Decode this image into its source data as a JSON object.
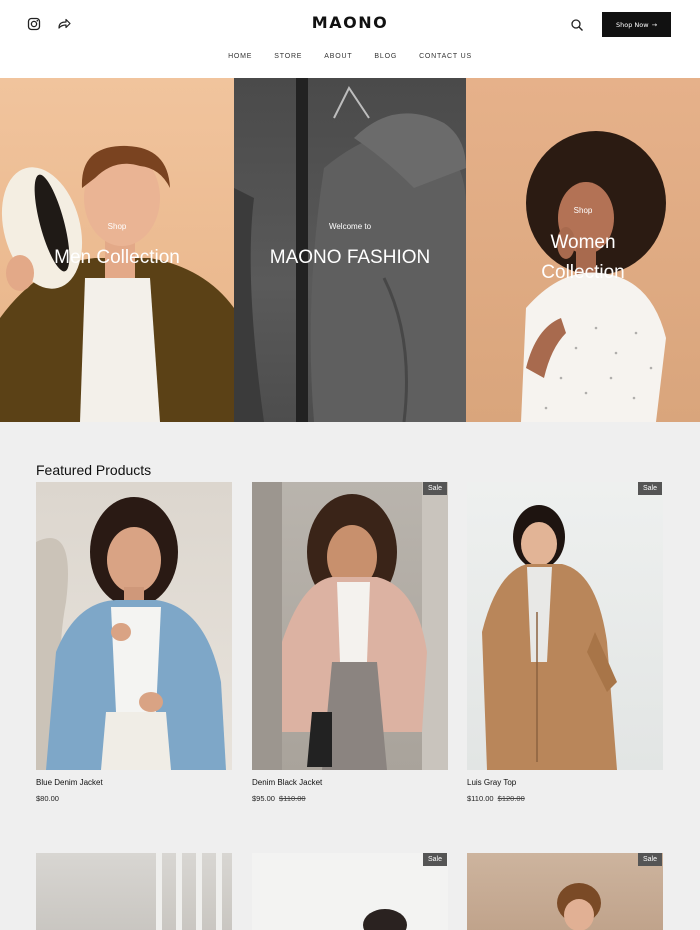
{
  "header": {
    "logo": "MAONO",
    "shop_button": "Shop Now",
    "shop_button_arrow": "→",
    "nav": [
      "HOME",
      "STORE",
      "ABOUT",
      "BLOG",
      "CONTACT US"
    ]
  },
  "icons": {
    "instagram": "instagram-icon",
    "share": "share-icon",
    "search": "search-icon"
  },
  "hero": {
    "men": {
      "small": "Shop",
      "title": "Men Collection"
    },
    "center": {
      "small": "Welcome to",
      "title": "MAONO FASHION"
    },
    "women": {
      "small": "Shop",
      "title_line1": "Women",
      "title_line2": "Collection"
    }
  },
  "featured": {
    "title": "Featured Products",
    "products": [
      {
        "name": "Blue Denim Jacket",
        "price": "$80.00",
        "old_price": "",
        "sale": ""
      },
      {
        "name": "Denim Black Jacket",
        "price": "$95.00",
        "old_price": "$110.00",
        "sale": "Sale"
      },
      {
        "name": "Luis Gray Top",
        "price": "$110.00",
        "old_price": "$120.00",
        "sale": "Sale"
      }
    ],
    "second_row": [
      {
        "sale": ""
      },
      {
        "sale": "Sale"
      },
      {
        "sale": "Sale"
      }
    ]
  },
  "colors": {
    "accent": "#111111",
    "background": "#efefef",
    "sale_badge": "#555555"
  }
}
